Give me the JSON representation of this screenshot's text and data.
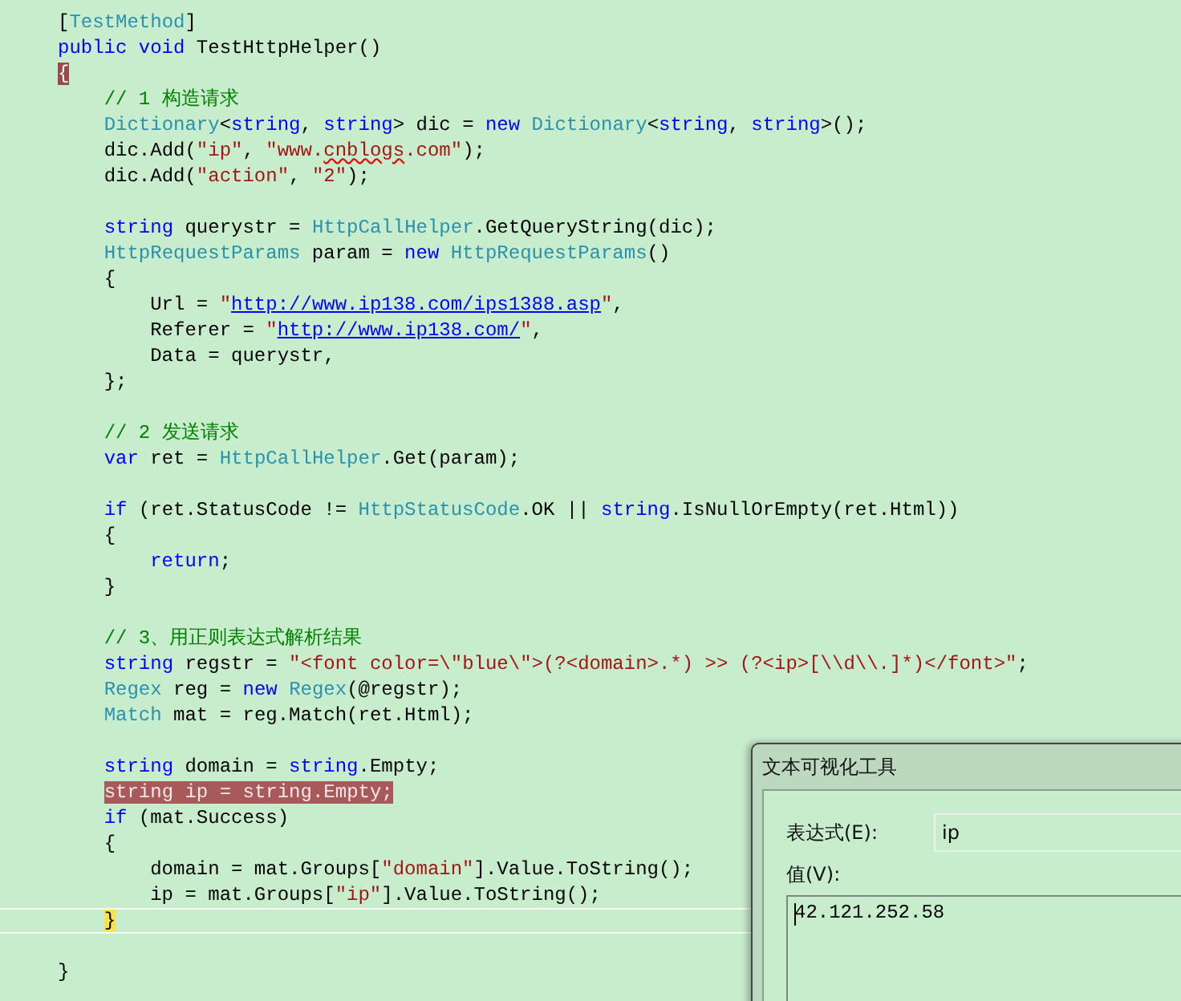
{
  "editor": {
    "lines": [
      {
        "kind": "code",
        "breakpoint": false,
        "current": false,
        "tokens": [
          {
            "kind": "plain",
            "text": "["
          },
          {
            "kind": "type",
            "text": "TestMethod"
          },
          {
            "kind": "plain",
            "text": "]"
          }
        ]
      },
      {
        "kind": "code",
        "breakpoint": false,
        "current": false,
        "tokens": [
          {
            "kind": "keyword",
            "text": "public void"
          },
          {
            "kind": "plain",
            "text": " TestHttpHelper()"
          }
        ]
      },
      {
        "kind": "code",
        "breakpoint": false,
        "current": false,
        "tokens": [
          {
            "kind": "brace-match",
            "text": "{"
          }
        ]
      },
      {
        "kind": "code",
        "breakpoint": false,
        "current": false,
        "tokens": [
          {
            "kind": "comment",
            "text": "    // 1 构造请求"
          }
        ]
      },
      {
        "kind": "code",
        "breakpoint": false,
        "current": false,
        "tokens": [
          {
            "kind": "type",
            "text": "    Dictionary"
          },
          {
            "kind": "plain",
            "text": "<"
          },
          {
            "kind": "keyword",
            "text": "string"
          },
          {
            "kind": "plain",
            "text": ", "
          },
          {
            "kind": "keyword",
            "text": "string"
          },
          {
            "kind": "plain",
            "text": "> dic = "
          },
          {
            "kind": "keyword",
            "text": "new "
          },
          {
            "kind": "type",
            "text": "Dictionary"
          },
          {
            "kind": "plain",
            "text": "<"
          },
          {
            "kind": "keyword",
            "text": "string"
          },
          {
            "kind": "plain",
            "text": ", "
          },
          {
            "kind": "keyword",
            "text": "string"
          },
          {
            "kind": "plain",
            "text": ">();"
          }
        ]
      },
      {
        "kind": "code",
        "breakpoint": false,
        "current": false,
        "tokens": [
          {
            "kind": "plain",
            "text": "    dic.Add("
          },
          {
            "kind": "string",
            "text": "\"ip\""
          },
          {
            "kind": "plain",
            "text": ", "
          },
          {
            "kind": "string",
            "text": "\"www."
          },
          {
            "kind": "squiggle",
            "text": "cnblogs"
          },
          {
            "kind": "string",
            "text": ".com\""
          },
          {
            "kind": "plain",
            "text": ");"
          }
        ]
      },
      {
        "kind": "code",
        "breakpoint": false,
        "current": false,
        "tokens": [
          {
            "kind": "plain",
            "text": "    dic.Add("
          },
          {
            "kind": "string",
            "text": "\"action\""
          },
          {
            "kind": "plain",
            "text": ", "
          },
          {
            "kind": "string",
            "text": "\"2\""
          },
          {
            "kind": "plain",
            "text": ");"
          }
        ]
      },
      {
        "kind": "blank"
      },
      {
        "kind": "code",
        "breakpoint": false,
        "current": false,
        "tokens": [
          {
            "kind": "keyword",
            "text": "    string"
          },
          {
            "kind": "plain",
            "text": " querystr = "
          },
          {
            "kind": "type",
            "text": "HttpCallHelper"
          },
          {
            "kind": "plain",
            "text": ".GetQueryString(dic);"
          }
        ]
      },
      {
        "kind": "code",
        "breakpoint": false,
        "current": false,
        "tokens": [
          {
            "kind": "type",
            "text": "    HttpRequestParams"
          },
          {
            "kind": "plain",
            "text": " param = "
          },
          {
            "kind": "keyword",
            "text": "new "
          },
          {
            "kind": "type",
            "text": "HttpRequestParams"
          },
          {
            "kind": "plain",
            "text": "()"
          }
        ]
      },
      {
        "kind": "code",
        "breakpoint": false,
        "current": false,
        "tokens": [
          {
            "kind": "plain",
            "text": "    {"
          }
        ]
      },
      {
        "kind": "code",
        "breakpoint": false,
        "current": false,
        "tokens": [
          {
            "kind": "plain",
            "text": "        Url = "
          },
          {
            "kind": "string",
            "text": "\""
          },
          {
            "kind": "url",
            "text": "http://www.ip138.com/ips1388.asp"
          },
          {
            "kind": "string",
            "text": "\""
          },
          {
            "kind": "plain",
            "text": ","
          }
        ]
      },
      {
        "kind": "code",
        "breakpoint": false,
        "current": false,
        "tokens": [
          {
            "kind": "plain",
            "text": "        Referer = "
          },
          {
            "kind": "string",
            "text": "\""
          },
          {
            "kind": "url",
            "text": "http://www.ip138.com/"
          },
          {
            "kind": "string",
            "text": "\""
          },
          {
            "kind": "plain",
            "text": ","
          }
        ]
      },
      {
        "kind": "code",
        "breakpoint": false,
        "current": false,
        "tokens": [
          {
            "kind": "plain",
            "text": "        Data = querystr,"
          }
        ]
      },
      {
        "kind": "code",
        "breakpoint": false,
        "current": false,
        "tokens": [
          {
            "kind": "plain",
            "text": "    };"
          }
        ]
      },
      {
        "kind": "blank"
      },
      {
        "kind": "code",
        "breakpoint": false,
        "current": false,
        "tokens": [
          {
            "kind": "comment",
            "text": "    // 2 发送请求"
          }
        ]
      },
      {
        "kind": "code",
        "breakpoint": false,
        "current": false,
        "tokens": [
          {
            "kind": "keyword",
            "text": "    var"
          },
          {
            "kind": "plain",
            "text": " ret = "
          },
          {
            "kind": "type",
            "text": "HttpCallHelper"
          },
          {
            "kind": "plain",
            "text": ".Get(param);"
          }
        ]
      },
      {
        "kind": "blank"
      },
      {
        "kind": "code",
        "breakpoint": false,
        "current": false,
        "tokens": [
          {
            "kind": "keyword",
            "text": "    if"
          },
          {
            "kind": "plain",
            "text": " (ret.StatusCode != "
          },
          {
            "kind": "type",
            "text": "HttpStatusCode"
          },
          {
            "kind": "plain",
            "text": ".OK || "
          },
          {
            "kind": "keyword",
            "text": "string"
          },
          {
            "kind": "plain",
            "text": ".IsNullOrEmpty(ret.Html))"
          }
        ]
      },
      {
        "kind": "code",
        "breakpoint": false,
        "current": false,
        "tokens": [
          {
            "kind": "plain",
            "text": "    {"
          }
        ]
      },
      {
        "kind": "code",
        "breakpoint": false,
        "current": false,
        "tokens": [
          {
            "kind": "keyword",
            "text": "        return"
          },
          {
            "kind": "plain",
            "text": ";"
          }
        ]
      },
      {
        "kind": "code",
        "breakpoint": false,
        "current": false,
        "tokens": [
          {
            "kind": "plain",
            "text": "    }"
          }
        ]
      },
      {
        "kind": "blank"
      },
      {
        "kind": "code",
        "breakpoint": false,
        "current": false,
        "tokens": [
          {
            "kind": "comment",
            "text": "    // 3、用正则表达式解析结果"
          }
        ]
      },
      {
        "kind": "code",
        "breakpoint": false,
        "current": false,
        "tokens": [
          {
            "kind": "keyword",
            "text": "    string"
          },
          {
            "kind": "plain",
            "text": " regstr = "
          },
          {
            "kind": "string",
            "text": "\"<font color=\\\"blue\\\">(?<domain>.*) >> (?<ip>[\\\\d\\\\.]*)</font>\""
          },
          {
            "kind": "plain",
            "text": ";"
          }
        ]
      },
      {
        "kind": "code",
        "breakpoint": false,
        "current": false,
        "tokens": [
          {
            "kind": "type",
            "text": "    Regex"
          },
          {
            "kind": "plain",
            "text": " reg = "
          },
          {
            "kind": "keyword",
            "text": "new "
          },
          {
            "kind": "type",
            "text": "Regex"
          },
          {
            "kind": "plain",
            "text": "(@regstr);"
          }
        ]
      },
      {
        "kind": "code",
        "breakpoint": false,
        "current": false,
        "tokens": [
          {
            "kind": "type",
            "text": "    Match"
          },
          {
            "kind": "plain",
            "text": " mat = reg.Match(ret.Html);"
          }
        ]
      },
      {
        "kind": "blank"
      },
      {
        "kind": "code",
        "breakpoint": false,
        "current": false,
        "tokens": [
          {
            "kind": "keyword",
            "text": "    string"
          },
          {
            "kind": "plain",
            "text": " domain = "
          },
          {
            "kind": "keyword",
            "text": "string"
          },
          {
            "kind": "plain",
            "text": ".Empty;"
          }
        ]
      },
      {
        "kind": "code",
        "breakpoint": true,
        "current": false,
        "tokens": [
          {
            "kind": "keyword",
            "text": "    string"
          },
          {
            "kind": "plain",
            "text": " ip = "
          },
          {
            "kind": "keyword",
            "text": "string"
          },
          {
            "kind": "plain",
            "text": ".Empty;"
          }
        ]
      },
      {
        "kind": "code",
        "breakpoint": false,
        "current": false,
        "tokens": [
          {
            "kind": "keyword",
            "text": "    if"
          },
          {
            "kind": "plain",
            "text": " (mat.Success)"
          }
        ]
      },
      {
        "kind": "code",
        "breakpoint": false,
        "current": false,
        "tokens": [
          {
            "kind": "plain",
            "text": "    {"
          }
        ]
      },
      {
        "kind": "code",
        "breakpoint": false,
        "current": false,
        "tokens": [
          {
            "kind": "plain",
            "text": "        domain = mat.Groups["
          },
          {
            "kind": "string",
            "text": "\"domain\""
          },
          {
            "kind": "plain",
            "text": "].Value.ToString();"
          }
        ]
      },
      {
        "kind": "code",
        "breakpoint": false,
        "current": false,
        "tokens": [
          {
            "kind": "plain",
            "text": "        ip = mat.Groups["
          },
          {
            "kind": "string",
            "text": "\"ip\""
          },
          {
            "kind": "plain",
            "text": "].Value.ToString();"
          }
        ]
      },
      {
        "kind": "code",
        "breakpoint": false,
        "current": true,
        "tokens": [
          {
            "kind": "current-brace",
            "text": "    }"
          }
        ]
      },
      {
        "kind": "blank"
      },
      {
        "kind": "code",
        "breakpoint": false,
        "current": false,
        "tokens": [
          {
            "kind": "plain",
            "text": "}"
          }
        ]
      }
    ]
  },
  "visualizer": {
    "title": "文本可视化工具",
    "expression_label": "表达式(E):",
    "expression": "ip",
    "value_label": "值(V):",
    "value": "42.121.252.58"
  }
}
